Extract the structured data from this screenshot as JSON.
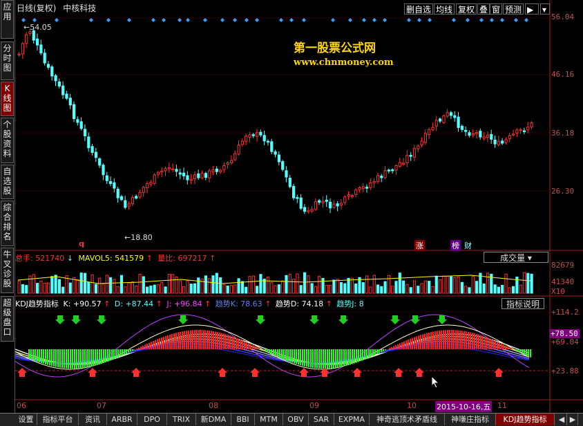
{
  "window": {
    "title": "日线(复权)",
    "stock_name": "中核科技"
  },
  "left_nav": [
    {
      "label": "应用"
    },
    {
      "label": "分时图"
    },
    {
      "label": "K线图",
      "active": true
    },
    {
      "label": "个股资料"
    },
    {
      "label": "自选股"
    },
    {
      "label": "综合排名"
    },
    {
      "label": "牛叉诊股"
    },
    {
      "label": "超级盘口"
    }
  ],
  "toolbar": {
    "items": [
      "删自选",
      "均线",
      "复权",
      "叠",
      "窗",
      "预测"
    ]
  },
  "price_axis": [
    "56.04",
    "46.16",
    "36.18",
    "26.30"
  ],
  "annotations": {
    "high": "54.05",
    "low": "18.80",
    "zhang": "涨",
    "bang": "榜",
    "cai": "财",
    "q": "q"
  },
  "watermark": {
    "line1": "第一股票公式网",
    "line2": "www.chnmoney.com"
  },
  "volume_panel": {
    "total_label": "总手:",
    "total_value": "521740",
    "mavol_label": "MAVOL5:",
    "mavol_value": "541579",
    "ratio_label": "量比:",
    "ratio_value": "697217",
    "dropdown": "成交量",
    "axis": [
      "82679",
      "41340",
      "X10"
    ]
  },
  "kdj_panel": {
    "title": "KDJ趋势指标",
    "k": "K: +90.57",
    "d": "D: +87.44",
    "j": "J: +96.84",
    "tk": "趋势K: 78.63",
    "td": "趋势D: 74.18",
    "tj": "趋势J: 8",
    "help": "指标说明",
    "axis": [
      "+114.2",
      "+78.50",
      "+69.04",
      "+23.88"
    ]
  },
  "date_axis": [
    "06",
    "07",
    "08",
    "09",
    "10",
    "2015-10-16,五",
    "11"
  ],
  "bottom_tabs": [
    "设置",
    "指标平台",
    "资讯",
    "ARBR",
    "DPO",
    "TRIX",
    "新DMA",
    "BBI",
    "MTM",
    "OBV",
    "SAR",
    "EXPMA",
    "神奇逃顶术矛盾线",
    "神嗛庄指标",
    "KDJ趋势指标"
  ],
  "colors": {
    "up": "#ff3030",
    "down": "#54ffff",
    "axis": "#a02020",
    "grid": "#600000"
  }
}
